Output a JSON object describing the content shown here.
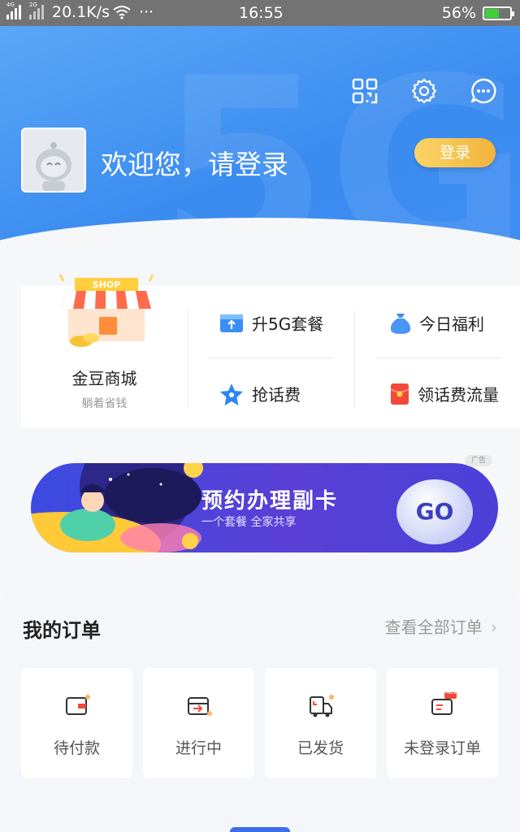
{
  "status_bar": {
    "network_tag_1": "4G",
    "network_tag_2": "2G",
    "speed": "20.1K/s",
    "more": "···",
    "time": "16:55",
    "battery": "56%",
    "battery_level": 0.56
  },
  "header": {
    "icons": [
      "qr-scan-icon",
      "settings-gear-icon",
      "message-chat-icon"
    ],
    "welcome_text": "欢迎您，请登录",
    "login_label": "登录",
    "bg_watermark": "5G"
  },
  "quick": {
    "shop_sign": "SHOP",
    "shop_label": "金豆商城",
    "shop_sub": "躺着省钱",
    "items": [
      {
        "label": "升5G套餐",
        "icon": "upgrade-card-icon"
      },
      {
        "label": "今日福利",
        "icon": "money-bag-icon"
      },
      {
        "label": "抢话费",
        "icon": "star-icon"
      },
      {
        "label": "领话费流量",
        "icon": "red-envelope-icon"
      }
    ]
  },
  "banner": {
    "ad_badge": "广告",
    "title": "预约办理副卡",
    "subtitle": "一个套餐  全家共享",
    "go_label": "GO"
  },
  "orders": {
    "title": "我的订单",
    "view_all": "查看全部订单",
    "chevron": "›",
    "new_badge": "New",
    "cards": [
      {
        "label": "待付款",
        "icon": "wallet-icon"
      },
      {
        "label": "进行中",
        "icon": "in-progress-icon"
      },
      {
        "label": "已发货",
        "icon": "delivery-truck-icon"
      },
      {
        "label": "未登录订单",
        "icon": "card-new-icon"
      }
    ]
  },
  "colors": {
    "header_blue": "#3b8cf0",
    "login_gold": "#f2b33a",
    "banner_purple": "#4b40d8"
  }
}
